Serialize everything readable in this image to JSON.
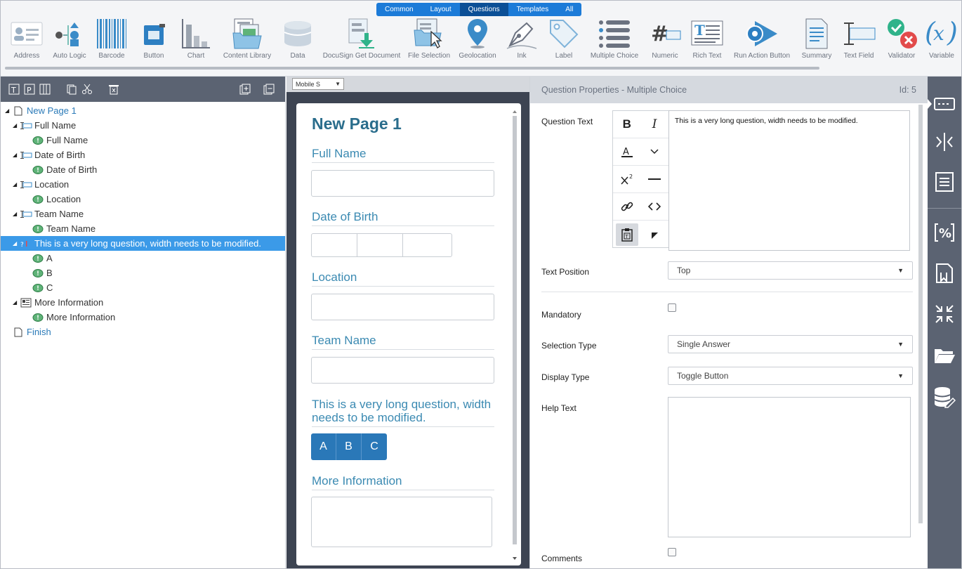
{
  "toolbar": {
    "tabs": [
      "Common",
      "Layout",
      "Questions",
      "Templates",
      "All"
    ],
    "active_tab": "Questions",
    "tools": [
      {
        "label": "Address",
        "icon": "address-card-icon"
      },
      {
        "label": "Auto Logic",
        "icon": "auto-logic-icon"
      },
      {
        "label": "Barcode",
        "icon": "barcode-icon"
      },
      {
        "label": "Button",
        "icon": "button-icon"
      },
      {
        "label": "Chart",
        "icon": "chart-icon"
      },
      {
        "label": "Content Library",
        "icon": "content-library-icon"
      },
      {
        "label": "Data",
        "icon": "database-icon"
      },
      {
        "label": "DocuSign Get Document",
        "icon": "docusign-icon"
      },
      {
        "label": "File Selection",
        "icon": "file-selection-icon"
      },
      {
        "label": "Geolocation",
        "icon": "map-pin-icon"
      },
      {
        "label": "Ink",
        "icon": "pen-nib-icon"
      },
      {
        "label": "Label",
        "icon": "tag-icon"
      },
      {
        "label": "Multiple Choice",
        "icon": "list-icon"
      },
      {
        "label": "Numeric",
        "icon": "hash-icon"
      },
      {
        "label": "Rich Text",
        "icon": "rich-text-icon"
      },
      {
        "label": "Run Action Button",
        "icon": "run-action-icon"
      },
      {
        "label": "Summary",
        "icon": "summary-icon"
      },
      {
        "label": "Text Field",
        "icon": "text-field-icon"
      },
      {
        "label": "Validator",
        "icon": "validator-icon"
      },
      {
        "label": "Variable",
        "icon": "variable-icon"
      }
    ]
  },
  "tree": {
    "items": [
      {
        "label": "New Page 1",
        "level": 0,
        "type": "page"
      },
      {
        "label": "Full Name",
        "level": 1,
        "type": "field"
      },
      {
        "label": "Full Name",
        "level": 2,
        "type": "label"
      },
      {
        "label": "Date of Birth",
        "level": 1,
        "type": "field"
      },
      {
        "label": "Date of Birth",
        "level": 2,
        "type": "label"
      },
      {
        "label": "Location",
        "level": 1,
        "type": "field"
      },
      {
        "label": "Location",
        "level": 2,
        "type": "label"
      },
      {
        "label": "Team Name",
        "level": 1,
        "type": "field"
      },
      {
        "label": "Team Name",
        "level": 2,
        "type": "label"
      },
      {
        "label": "This is a very long question, width needs to be modified.",
        "level": 1,
        "type": "choice",
        "selected": true
      },
      {
        "label": "A",
        "level": 2,
        "type": "label"
      },
      {
        "label": "B",
        "level": 2,
        "type": "label"
      },
      {
        "label": "C",
        "level": 2,
        "type": "label"
      },
      {
        "label": "More Information",
        "level": 1,
        "type": "memo"
      },
      {
        "label": "More Information",
        "level": 2,
        "type": "label"
      },
      {
        "label": "Finish",
        "level": 0,
        "type": "page"
      }
    ]
  },
  "preview": {
    "device": "Mobile S",
    "title": "New Page 1",
    "q_full_name": "Full Name",
    "q_dob": "Date of Birth",
    "q_location": "Location",
    "q_team": "Team Name",
    "q_long": "This is a very long question, width needs to be modified.",
    "choices": [
      "A",
      "B",
      "C"
    ],
    "q_more": "More Information"
  },
  "properties": {
    "header": "Question Properties - Multiple Choice",
    "id_label": "Id: 5",
    "question_text_label": "Question Text",
    "question_text": "This is a very long question, width needs to be modified.",
    "text_position_label": "Text Position",
    "text_position": "Top",
    "mandatory_label": "Mandatory",
    "selection_type_label": "Selection Type",
    "selection_type": "Single Answer",
    "display_type_label": "Display Type",
    "display_type": "Toggle Button",
    "help_text_label": "Help Text",
    "comments_label": "Comments"
  },
  "colors": {
    "accent": "#1c7bd8",
    "selected_row": "#3b9ae8",
    "panel_dark": "#5b6372",
    "question_text": "#3b8ab2"
  }
}
